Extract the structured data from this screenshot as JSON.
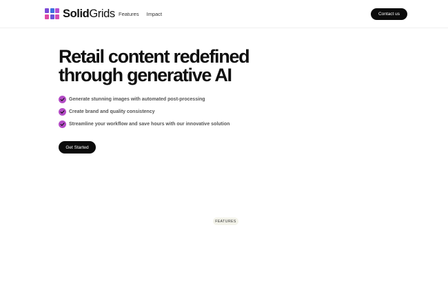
{
  "brand": {
    "name_bold": "Solid",
    "name_light": "Grids",
    "colors": [
      "#7d4bd6",
      "#3f6fe0",
      "#b54fd2",
      "#e04aa4",
      "#6a53d8",
      "#d54cb4"
    ]
  },
  "nav": {
    "items": [
      {
        "label": "Features"
      },
      {
        "label": "Impact"
      }
    ],
    "contact_label": "Contact us"
  },
  "hero": {
    "title": "Retail content redefined through generative AI",
    "bullets": [
      {
        "text": "Generate stunning images with automated post-processing",
        "icon": "check-icon"
      },
      {
        "text": "Create brand and quality consistency",
        "icon": "check-icon"
      },
      {
        "text": "Streamline your workflow and save hours with our innovative solution",
        "icon": "check-icon"
      }
    ],
    "cta_label": "Get Started",
    "accent_color": "#b44cc6"
  },
  "features_section": {
    "badge": "FEATURES"
  }
}
